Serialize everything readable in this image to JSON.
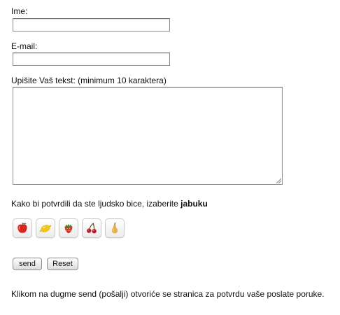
{
  "form": {
    "name_label": "Ime:",
    "name_value": "",
    "email_label": "E-mail:",
    "email_value": "",
    "message_label": "Upišite Vaš tekst: (minimum 10 karaktera)",
    "message_value": ""
  },
  "captcha": {
    "prompt_text": "Kako bi potvrdili da ste ljudsko bice, izaberite ",
    "target_word": "jabuku",
    "options": [
      {
        "icon": "apple-icon",
        "color": "#d8261c"
      },
      {
        "icon": "lemon-icon",
        "color": "#f0c419"
      },
      {
        "icon": "strawberry-icon",
        "color": "#c63a2c"
      },
      {
        "icon": "cherries-icon",
        "color": "#b51d2a"
      },
      {
        "icon": "pear-icon",
        "color": "#e1b04a"
      }
    ]
  },
  "buttons": {
    "send_label": "send",
    "reset_label": "Reset"
  },
  "footer": {
    "note": "Klikom na dugme send (pošalji) otvoriće se stranica za potvrdu vaše poslate poruke."
  }
}
